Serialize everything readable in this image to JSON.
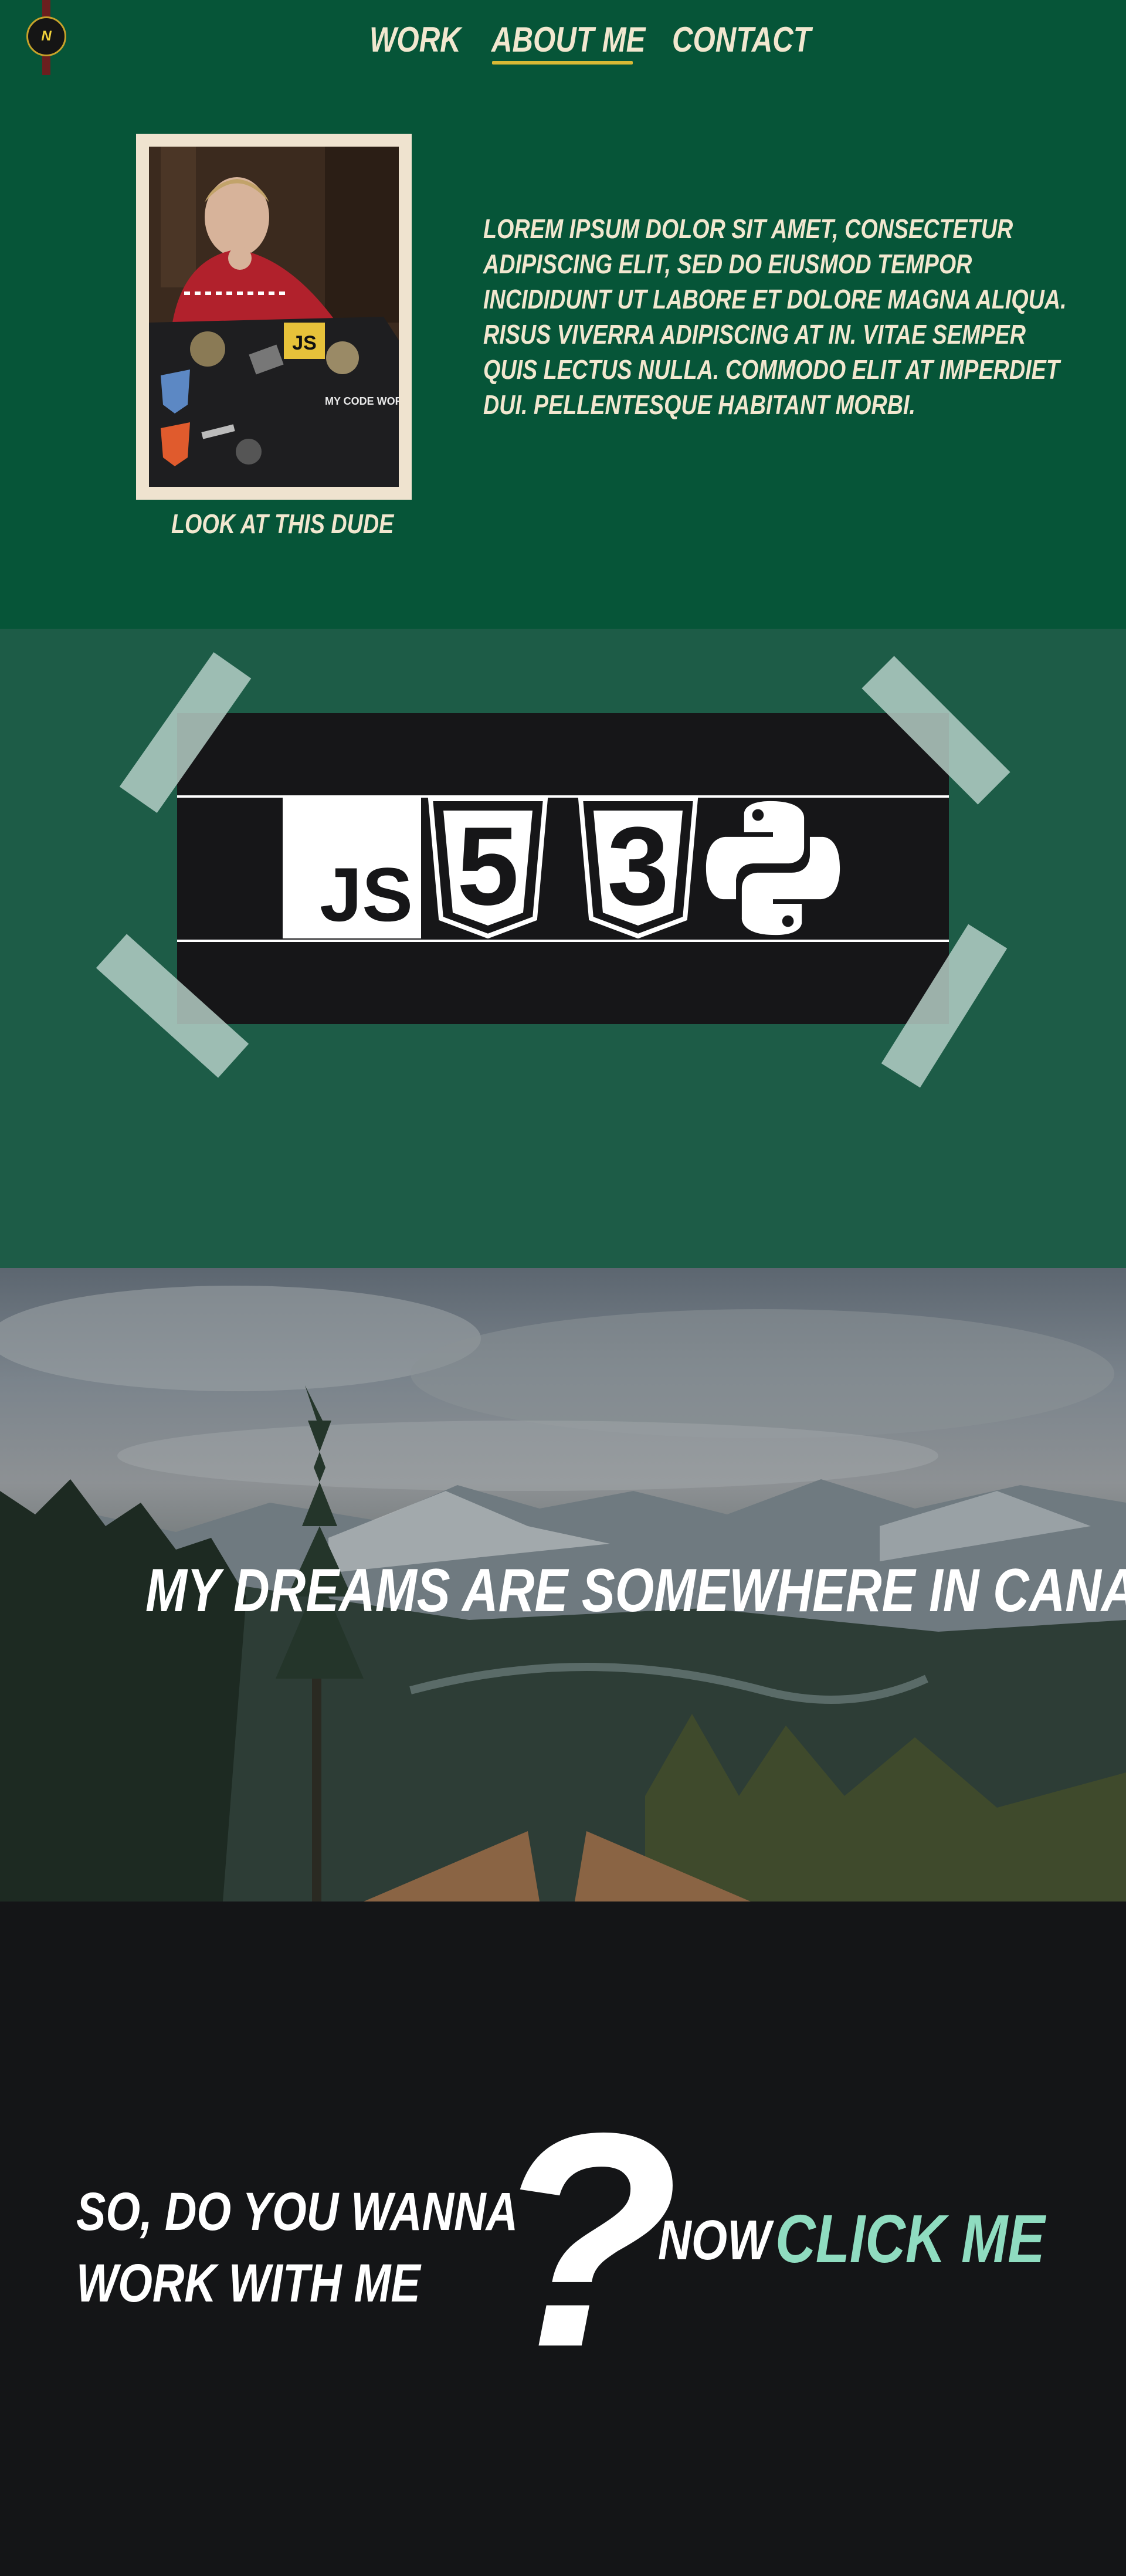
{
  "header": {
    "logo_letter": "N",
    "nav": [
      {
        "label": "WORK"
      },
      {
        "label": "ABOUT ME"
      },
      {
        "label": "CONTACT"
      }
    ],
    "active_nav": "ABOUT ME",
    "accent_color": "#d8b935"
  },
  "about": {
    "photo_caption": "LOOK AT THIS DUDE",
    "body": "LOREM IPSUM DOLOR SIT AMET, CONSECTETUR ADIPISCING ELIT, SED DO EIUSMOD TEMPOR INCIDIDUNT UT LABORE ET DOLORE MAGNA ALIQUA. RISUS VIVERRA ADIPISCING AT IN. VITAE SEMPER QUIS LECTUS NULLA. COMMODO ELIT AT IMPERDIET DUI. PELLENTESQUE HABITANT MORBI.",
    "body_lines": [
      "LOREM IPSUM DOLOR SIT AMET, CONSECTETUR",
      "ADIPISCING ELIT, SED DO EIUSMOD TEMPOR",
      "INCIDIDUNT UT LABORE ET DOLORE MAGNA ALIQUA.",
      "RISUS VIVERRA ADIPISCING AT IN. VITAE SEMPER",
      "QUIS LECTUS NULLA. COMMODO ELIT AT IMPERDIET",
      "DUI. PELLENTESQUE HABITANT MORBI."
    ],
    "laptop_sticker_js": "JS",
    "laptop_sticker_text": "MY CODE WORKS"
  },
  "tech": {
    "icons": [
      "javascript-icon",
      "html5-icon",
      "css3-icon",
      "python-icon"
    ],
    "js_label": "JS",
    "html_digit": "5",
    "css_digit": "3"
  },
  "canada": {
    "title": "MY DREAMS ARE SOMEWHERE IN CANADA"
  },
  "cta": {
    "question_line1": "SO, DO YOU WANNA",
    "question_line2": "WORK WITH ME",
    "question_mark": "?",
    "now_label": "NOW",
    "click_label": "CLICK ME",
    "click_color": "#8fdcc0"
  },
  "colors": {
    "about_bg": "#065538",
    "tech_bg": "#1d5c47",
    "dark_bg": "#141517",
    "cream": "#f1e7cf"
  }
}
